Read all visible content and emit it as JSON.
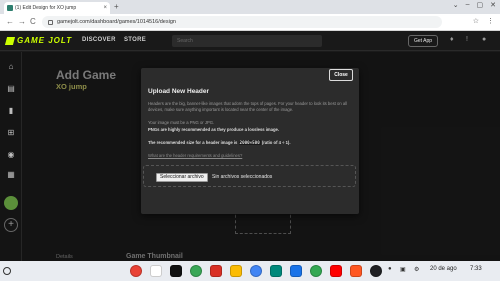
{
  "browser": {
    "tab_title": "(1) Edit Design for XO jump",
    "tab_close": "×",
    "new_tab": "+",
    "url": "gamejolt.com/dashboard/games/1014516/design",
    "window_controls": [
      "⌄",
      "–",
      "▢",
      "✕"
    ],
    "nav": {
      "back": "←",
      "forward": "→",
      "reload": "C"
    },
    "toolbar_icons": [
      "☆",
      "⋮"
    ]
  },
  "site": {
    "logo_text": "GAME JOLT",
    "nav": {
      "discover": "DISCOVER",
      "store": "STORE"
    },
    "search_placeholder": "Search",
    "get_app": "Get App",
    "header_icons": [
      "bell-icon",
      "notifications-icon",
      "user-icon"
    ],
    "header_glyphs": [
      "♦",
      "!",
      "●"
    ]
  },
  "sidebar": {
    "icons": [
      {
        "name": "home-icon",
        "glyph": "⌂"
      },
      {
        "name": "library-icon",
        "glyph": "▤"
      },
      {
        "name": "lock-icon",
        "glyph": "▮"
      },
      {
        "name": "cart-icon",
        "glyph": "⊞"
      },
      {
        "name": "explore-icon",
        "glyph": "◉"
      },
      {
        "name": "stats-icon",
        "glyph": "▦"
      }
    ],
    "add_glyph": "+"
  },
  "page": {
    "title": "Add Game",
    "subtitle": "XO jump",
    "details_label": "Details",
    "thumbnail_label": "Game Thumbnail"
  },
  "modal": {
    "close_label": "Close",
    "title": "Upload New Header",
    "paragraph1": "Headers are the big, banner-like images that adorn the tops of pages. For your header to look its best on all devices, make sure anything important is located near the center of the image.",
    "paragraph2": "Your image must be a PNG or JPG.",
    "paragraph3": "PNGs are highly recommended as they produce a lossless image.",
    "size_prefix": "The recommended size for a header image is",
    "size_value": "2000×500",
    "size_ratio": "(ratio of 4 ÷ 1).",
    "help_link": "What are the header requirements and guidelines?",
    "file_button": "Seleccionar archivo",
    "file_status": "Sin archivos seleccionados"
  },
  "taskbar": {
    "date": "20 de ago",
    "time": "7:33",
    "apps": [
      {
        "name": "chrome-icon",
        "color": "#e94235"
      },
      {
        "name": "gmail-icon",
        "color": "#ffffff"
      },
      {
        "name": "threads-icon",
        "color": "#111111"
      },
      {
        "name": "apps-grid-icon",
        "color": "#3aa757"
      },
      {
        "name": "mail-icon",
        "color": "#d93025"
      },
      {
        "name": "drive-icon",
        "color": "#fbbc04"
      },
      {
        "name": "photos-icon",
        "color": "#4285f4"
      },
      {
        "name": "meet-icon",
        "color": "#00897b"
      },
      {
        "name": "files-icon",
        "color": "#1a73e8"
      },
      {
        "name": "play-store-icon",
        "color": "#34a853"
      },
      {
        "name": "youtube-icon",
        "color": "#ff0000"
      },
      {
        "name": "music-icon",
        "color": "#ff5722"
      },
      {
        "name": "terminal-icon",
        "color": "#202124"
      }
    ]
  }
}
